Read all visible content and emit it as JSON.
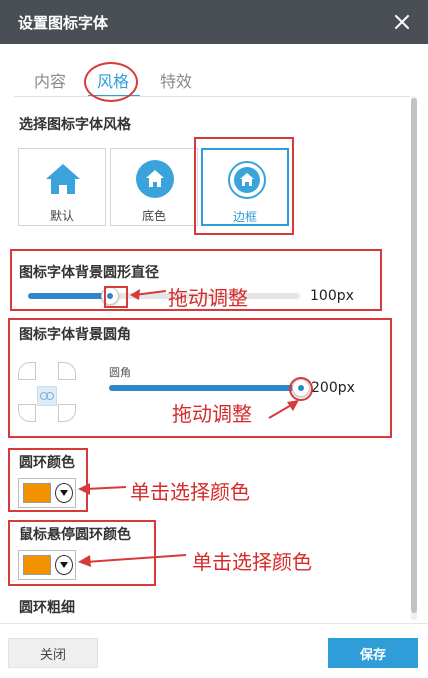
{
  "header": {
    "title": "设置图标字体",
    "close_icon": "close-icon"
  },
  "tabs": [
    {
      "label": "内容",
      "active": false
    },
    {
      "label": "风格",
      "active": true
    },
    {
      "label": "特效",
      "active": false
    }
  ],
  "style_section": {
    "title": "选择图标字体风格",
    "options": [
      {
        "label": "默认",
        "icon": "house-icon",
        "selected": false
      },
      {
        "label": "底色",
        "icon": "house-filled-circle-icon",
        "selected": false
      },
      {
        "label": "边框",
        "icon": "house-bordered-circle-icon",
        "selected": true
      }
    ]
  },
  "diameter": {
    "title": "图标字体背景圆形直径",
    "value_text": "100px",
    "fraction": 0.3
  },
  "radius": {
    "title": "图标字体背景圆角",
    "label": "圆角",
    "value_text": "200px",
    "fraction": 1.0,
    "link_icon": "link-icon"
  },
  "ring_color": {
    "title": "圆环颜色",
    "color": "#f39200"
  },
  "hover_ring_color": {
    "title": "鼠标悬停圆环颜色",
    "color": "#f39200"
  },
  "ring_width": {
    "title": "圆环粗细"
  },
  "annotations": {
    "drag": "拖动调整",
    "click_color": "单击选择颜色"
  },
  "footer": {
    "close_label": "关闭",
    "save_label": "保存"
  },
  "colors": {
    "accent": "#2f9ed8",
    "titlebar": "#4a4f55",
    "annotation": "#d83a3a"
  }
}
